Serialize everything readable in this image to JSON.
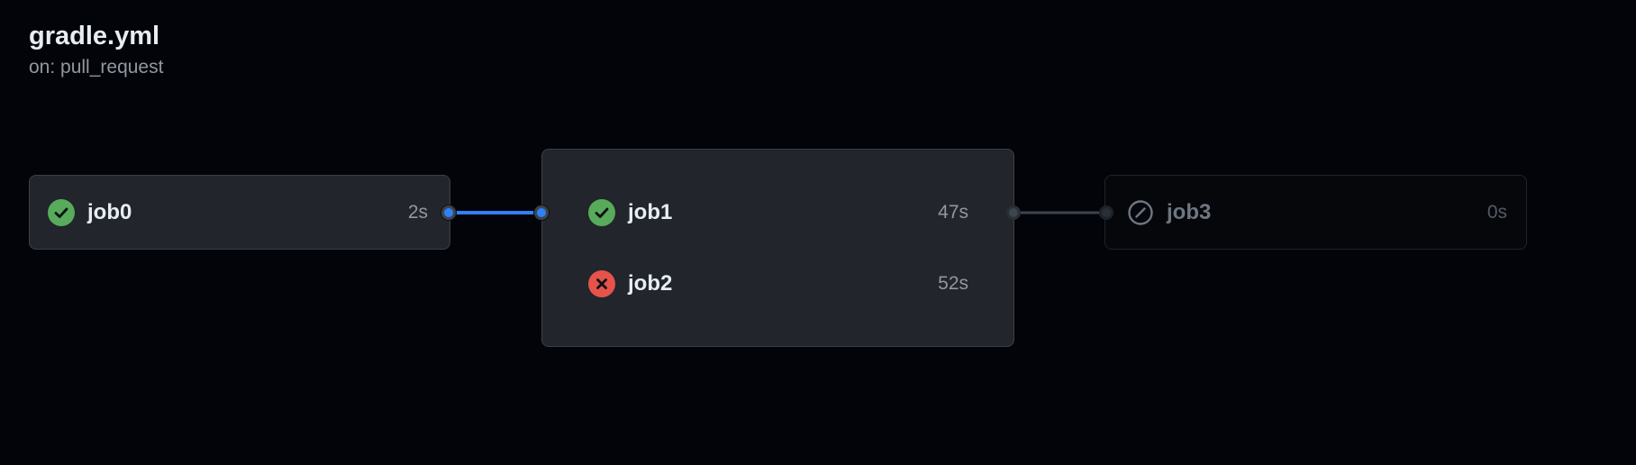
{
  "workflow": {
    "title": "gradle.yml",
    "trigger": "on: pull_request"
  },
  "jobs": [
    {
      "name": "job0",
      "duration": "2s",
      "status": "success",
      "status_icon": "check-circle-icon"
    },
    {
      "name": "job1",
      "duration": "47s",
      "status": "success",
      "status_icon": "check-circle-icon"
    },
    {
      "name": "job2",
      "duration": "52s",
      "status": "failure",
      "status_icon": "x-circle-icon"
    },
    {
      "name": "job3",
      "duration": "0s",
      "status": "skipped",
      "status_icon": "skip-icon"
    }
  ],
  "colors": {
    "background": "#020409",
    "card": "#22252b",
    "success": "#57ab5a",
    "failure": "#e5534b",
    "active_connector": "#2f81f7",
    "idle_connector": "#3d444d"
  }
}
